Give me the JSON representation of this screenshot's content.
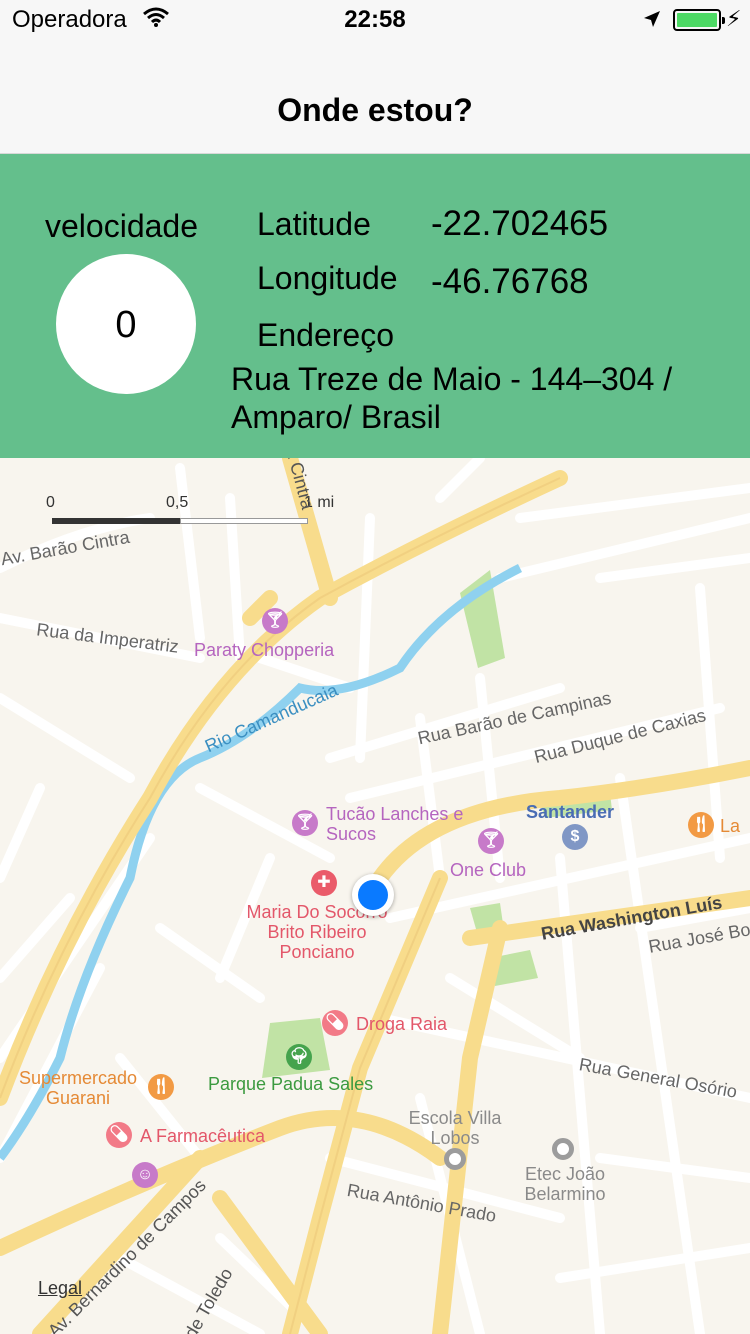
{
  "status_bar": {
    "carrier": "Operadora",
    "time": "22:58",
    "wifi_icon": "wifi-icon",
    "location_icon": "location-arrow-icon",
    "battery_icon": "battery-icon",
    "charging_icon": "bolt-icon",
    "battery_color": "#4cd964"
  },
  "nav": {
    "title": "Onde estou?"
  },
  "info": {
    "speed_label": "velocidade",
    "speed_value": "0",
    "latitude_label": "Latitude",
    "latitude_value": "-22.702465",
    "longitude_label": "Longitude",
    "longitude_value": "-46.76768",
    "address_label": "Endereço",
    "address_value": "Rua Treze de Maio - 144–304 / Amparo/ Brasil",
    "panel_color": "#64bf8c"
  },
  "map": {
    "scale": {
      "tick_0": "0",
      "tick_1": "0,5",
      "tick_2": "1 mi"
    },
    "streets": {
      "s1": "Av. Barão Cintra",
      "s2": "Rua da Imperatriz",
      "s3": "Rio Camanducaia",
      "s4": "Rua Barão de Campinas",
      "s5": "Rua Duque de Caxias",
      "s6": "Rua Washington Luís",
      "s7": "Rua José Bo",
      "s8": "Rua General Osório",
      "s9": "Rua Antônio Prado",
      "s10": "Av. Bernardino de Campos",
      "s11": "de Toledo",
      "s12": "a Cintra"
    },
    "pois": {
      "p1": "Paraty Chopperia",
      "p2": "Tucão Lanches e Sucos",
      "p3": "One Club",
      "p4": "Santander",
      "p5": "La",
      "p6": "Maria Do Socorro Brito Ribeiro Ponciano",
      "p7": "Droga Raia",
      "p8": "Parque Padua Sales",
      "p9": "Supermercado Guarani",
      "p10": "A Farmacêutica",
      "p11": "Escola Villa Lobos",
      "p12": "Etec João Belarmino"
    },
    "icons": {
      "bar": "cocktail-icon",
      "bank": "bank-icon",
      "restaurant": "restaurant-icon",
      "hospital": "hospital-icon",
      "pharmacy": "pill-icon",
      "park": "tree-icon",
      "school": "school-icon",
      "user": "user-location-icon"
    },
    "legal": "Legal"
  }
}
